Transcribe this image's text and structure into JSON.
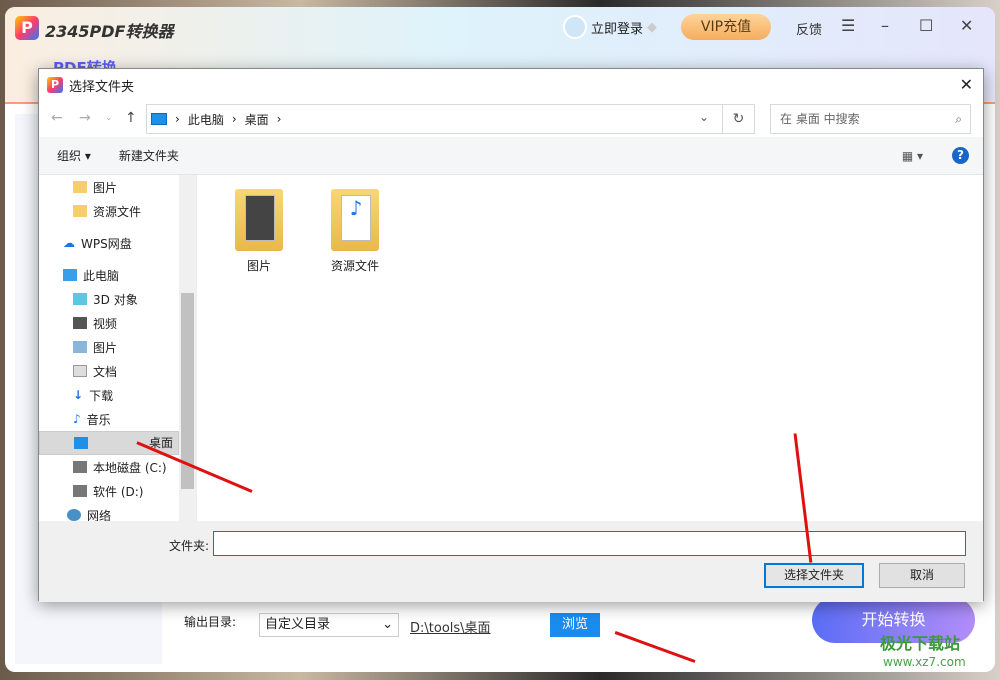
{
  "app": {
    "name": "2345PDF转换器",
    "login": "立即登录",
    "vip": "VIP充值",
    "feedback": "反馈",
    "menu_icon": "☰",
    "minimize": "–",
    "maximize": "☐",
    "close": "✕",
    "tab_active": "PDF转换",
    "output_label": "输出目录:",
    "output_select": "自定义目录",
    "output_path": "D:\\tools\\桌面",
    "browse": "浏览",
    "start": "开始转换"
  },
  "dialog": {
    "title": "选择文件夹",
    "close": "✕",
    "breadcrumb": [
      "此电脑",
      "桌面"
    ],
    "search_placeholder": "在 桌面 中搜索",
    "toolbar": {
      "organize": "组织 ▾",
      "new_folder": "新建文件夹",
      "help": "?"
    },
    "tree": [
      {
        "label": "图片",
        "icon": "folder-icon"
      },
      {
        "label": "资源文件",
        "icon": "folder-icon"
      },
      {
        "label": "WPS网盘",
        "icon": "cloud-icon"
      },
      {
        "label": "此电脑",
        "icon": "computer-icon"
      },
      {
        "label": "3D 对象",
        "icon": "cube-icon"
      },
      {
        "label": "视频",
        "icon": "video-icon"
      },
      {
        "label": "图片",
        "icon": "picture-icon"
      },
      {
        "label": "文档",
        "icon": "document-icon"
      },
      {
        "label": "下载",
        "icon": "download-icon"
      },
      {
        "label": "音乐",
        "icon": "music-icon"
      },
      {
        "label": "桌面",
        "icon": "desktop-icon",
        "selected": true
      },
      {
        "label": "本地磁盘 (C:)",
        "icon": "drive-icon"
      },
      {
        "label": "软件 (D:)",
        "icon": "drive-icon"
      },
      {
        "label": "网络",
        "icon": "network-icon"
      }
    ],
    "files": [
      {
        "label": "图片"
      },
      {
        "label": "资源文件"
      }
    ],
    "folder_label": "文件夹:",
    "folder_value": "",
    "ok": "选择文件夹",
    "cancel": "取消"
  },
  "watermark": {
    "text": "极光下载站",
    "url": "www.xz7.com"
  }
}
